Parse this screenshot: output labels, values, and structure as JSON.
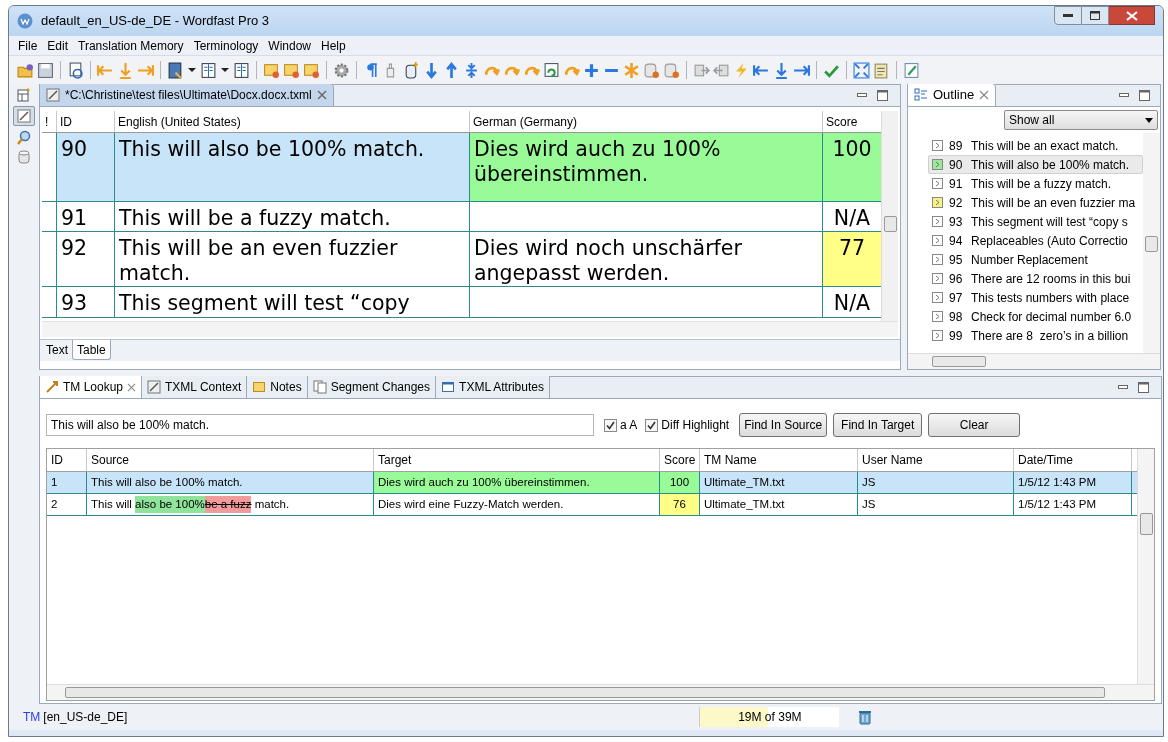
{
  "window": {
    "title": "default_en_US-de_DE - Wordfast Pro 3"
  },
  "menu": [
    "File",
    "Edit",
    "Translation Memory",
    "Terminology",
    "Window",
    "Help"
  ],
  "editor": {
    "tab": "*C:\\Christine\\test files\\Ultimate\\Docx.docx.txml",
    "columns": [
      "!",
      "ID",
      "English (United States)",
      "German (Germany)",
      "Score"
    ],
    "rows": [
      {
        "id": "90",
        "source": "This will also be 100% match.",
        "target": "Dies wird auch zu 100% übereinstimmen.",
        "score": "100",
        "color": "#98fb98",
        "selected": true
      },
      {
        "id": "91",
        "source": "This will be a fuzzy match.",
        "target": "",
        "score": "N/A",
        "selected": false
      },
      {
        "id": "92",
        "source": "This will be an even fuzzier match.",
        "target": "Dies wird noch unschärfer angepasst werden.",
        "score": "77",
        "color": "#ffff88",
        "selected": false
      },
      {
        "id": "93",
        "source": "This segment will test “copy",
        "target": "",
        "score": "N/A",
        "selected": false
      }
    ],
    "view_tabs": [
      {
        "label": "Text",
        "selected": false
      },
      {
        "label": "Table",
        "selected": true
      }
    ]
  },
  "outline": {
    "title": "Outline",
    "filter": "Show all",
    "items": [
      {
        "number": "89",
        "text": "This will be an exact match.",
        "selected": false
      },
      {
        "number": "90",
        "text": "This will also be 100% match.",
        "color": "#9be89b",
        "selected": true
      },
      {
        "number": "91",
        "text": "This will be a fuzzy match.",
        "selected": false
      },
      {
        "number": "92",
        "text": "This will be an even fuzzier ma",
        "color": "#f4f480",
        "selected": false
      },
      {
        "number": "93",
        "text": "This segment will test “copy s",
        "selected": false
      },
      {
        "number": "94",
        "text": "Replaceables (Auto Correctio",
        "selected": false
      },
      {
        "number": "95",
        "text": "Number Replacement",
        "selected": false
      },
      {
        "number": "96",
        "text": "There are 12 rooms in this bui",
        "selected": false
      },
      {
        "number": "97",
        "text": "This tests numbers with place",
        "selected": false
      },
      {
        "number": "98",
        "text": "Check for decimal number 6.0",
        "selected": false
      },
      {
        "number": "99",
        "text": "There are 8  zero’s in a billion",
        "selected": false
      }
    ]
  },
  "lookup": {
    "tabs": [
      {
        "label": "TM Lookup",
        "selected": true
      },
      {
        "label": "TXML Context",
        "selected": false
      },
      {
        "label": "Notes",
        "selected": false
      },
      {
        "label": "Segment Changes",
        "selected": false
      },
      {
        "label": "TXML Attributes",
        "selected": false
      }
    ],
    "query": "This will also be 100% match.",
    "options": [
      {
        "label": "a A",
        "checked": true
      },
      {
        "label": "Diff Highlight",
        "checked": true
      }
    ],
    "buttons": [
      "Find In Source",
      "Find In Target",
      "Clear"
    ],
    "columns": [
      "ID",
      "Source",
      "Target",
      "Score",
      "TM Name",
      "User Name",
      "Date/Time"
    ],
    "rows": [
      {
        "id": "1",
        "source": [
          {
            "kind": "plain",
            "text": "This will also be 100% match."
          }
        ],
        "target": "Dies wird auch zu 100% übereinstimmen.",
        "score": "100",
        "color": "#98fb98",
        "tm_name": "Ultimate_TM.txt",
        "user": "JS",
        "date": "1/5/12 1:43 PM",
        "selected": true
      },
      {
        "id": "2",
        "source": [
          {
            "kind": "plain",
            "text": "This will "
          },
          {
            "kind": "insert",
            "text": "also be 100%"
          },
          {
            "kind": "delete",
            "text": "be a fuzz"
          },
          {
            "kind": "plain",
            "text": " match."
          }
        ],
        "target": "Dies wird eine Fuzzy-Match werden.",
        "score": "76",
        "color": "#ffff88",
        "tm_name": "Ultimate_TM.txt",
        "user": "JS",
        "date": "1/5/12 1:43 PM",
        "selected": false
      }
    ]
  },
  "status_bar": {
    "mode": "TM",
    "locale": "[en_US-de_DE]",
    "memory": {
      "text": "19M of 39M",
      "level": 0.49
    }
  }
}
